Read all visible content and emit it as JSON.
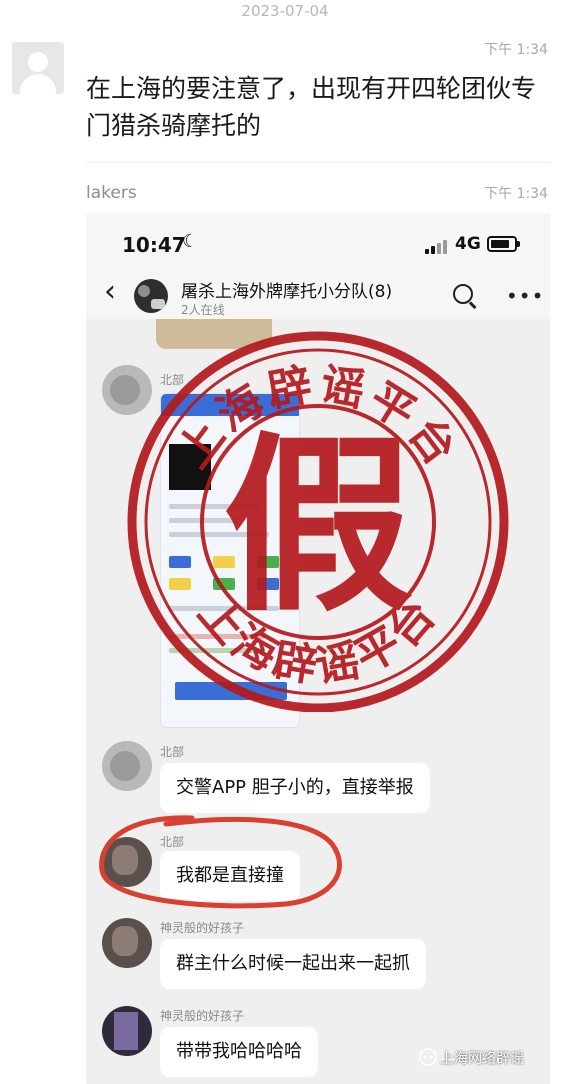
{
  "date_separator": "2023-07-04",
  "messages": [
    {
      "sender": "",
      "time": "下午 1:34",
      "text": "在上海的要注意了，出现有开四轮团伙专门猎杀骑摩托的"
    },
    {
      "sender": "lakers",
      "time": "下午 1:34"
    }
  ],
  "screenshot": {
    "clock": "10:47",
    "network": "4G",
    "group_title": "屠杀上海外牌摩托小分队(8)",
    "group_subtitle": "2人在线",
    "chat": [
      {
        "nick": "北部",
        "text": ""
      },
      {
        "nick": "北部",
        "text": "交警APP 胆子小的，直接举报"
      },
      {
        "nick": "北部",
        "text": "我都是直接撞"
      },
      {
        "nick": "神灵般的好孩子",
        "text": "群主什么时候一起出来一起抓"
      },
      {
        "nick": "神灵般的好孩子",
        "text": "带带我哈哈哈哈"
      }
    ]
  },
  "stamp": {
    "char": "假",
    "text_top": "上海辟谣平台",
    "text_bottom": "上海辟谣平台",
    "color": "#b3191c"
  },
  "highlight_color": "#d8412f",
  "watermark": "上海网络辟谣"
}
